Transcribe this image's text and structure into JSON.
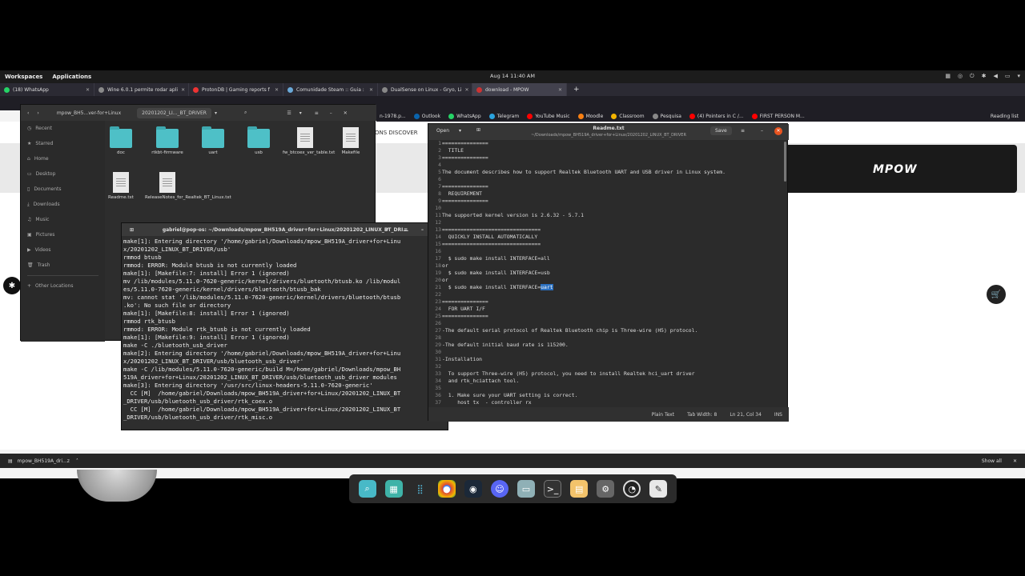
{
  "topbar": {
    "workspaces": "Workspaces",
    "applications": "Applications",
    "clock": "Aug 14  11:40 AM"
  },
  "tabs": [
    {
      "label": "(18) WhatsApp",
      "color": "#25d366"
    },
    {
      "label": "Wine 6.0.1 permite rodar apli",
      "color": "#8a8a8a"
    },
    {
      "label": "ProtonDB | Gaming reports f",
      "color": "#e33"
    },
    {
      "label": "Comunidade Steam :: Guia :",
      "color": "#1b2838"
    },
    {
      "label": "DualSense on Linux - Gryo, Li",
      "color": "#888"
    },
    {
      "label": "download - MPOW",
      "color": "#c33"
    }
  ],
  "bookmarks": [
    "n-1978.p...",
    "Outlook",
    "WhatsApp",
    "Telegram",
    "YouTube Music",
    "Moodle",
    "Classroom",
    "Pesquisa",
    "(4) Pointers in C /...",
    "FIRST PERSON M...",
    "Reading list"
  ],
  "webpage": {
    "discover": "ONS   DISCOVER",
    "logo": "MPOW"
  },
  "files": {
    "path_prefix": "mpow_BH5...ver-for+Linux",
    "path_current": "20201202_LI..._BT_DRIVER",
    "sidebar": [
      "Recent",
      "Starred",
      "Home",
      "Desktop",
      "Documents",
      "Downloads",
      "Music",
      "Pictures",
      "Videos",
      "Trash",
      "Other Locations"
    ],
    "items": [
      {
        "name": "doc",
        "type": "folder"
      },
      {
        "name": "rtkbt-firmware",
        "type": "folder"
      },
      {
        "name": "uart",
        "type": "folder"
      },
      {
        "name": "usb",
        "type": "folder"
      },
      {
        "name": "fw_btcoex_ver_table.txt",
        "type": "doc"
      },
      {
        "name": "Makefile",
        "type": "doc"
      },
      {
        "name": "Readme.txt",
        "type": "doc"
      },
      {
        "name": "ReleaseNotes_for_Realtek_BT_Linux.txt",
        "type": "doc"
      }
    ]
  },
  "terminal": {
    "title": "gabriel@pop-os: ~/Downloads/mpow_BH519A_driver+for+Linux/20201202_LINUX_BT_DRI...",
    "lines": "make[1]: Entering directory '/home/gabriel/Downloads/mpow_BH519A_driver+for+Linu\nx/20201202_LINUX_BT_DRIVER/usb'\nrmmod btusb\nrmmod: ERROR: Module btusb is not currently loaded\nmake[1]: [Makefile:7: install] Error 1 (ignored)\nmv /lib/modules/5.11.0-7620-generic/kernel/drivers/bluetooth/btusb.ko /lib/modul\nes/5.11.0-7620-generic/kernel/drivers/bluetooth/btusb_bak\nmv: cannot stat '/lib/modules/5.11.0-7620-generic/kernel/drivers/bluetooth/btusb\n.ko': No such file or directory\nmake[1]: [Makefile:8: install] Error 1 (ignored)\nrmmod rtk_btusb\nrmmod: ERROR: Module rtk_btusb is not currently loaded\nmake[1]: [Makefile:9: install] Error 1 (ignored)\nmake -C ./bluetooth_usb_driver\nmake[2]: Entering directory '/home/gabriel/Downloads/mpow_BH519A_driver+for+Linu\nx/20201202_LINUX_BT_DRIVER/usb/bluetooth_usb_driver'\nmake -C /lib/modules/5.11.0-7620-generic/build M=/home/gabriel/Downloads/mpow_BH\n519A_driver+for+Linux/20201202_LINUX_BT_DRIVER/usb/bluetooth_usb_driver modules\nmake[3]: Entering directory '/usr/src/linux-headers-5.11.0-7620-generic'\n  CC [M]  /home/gabriel/Downloads/mpow_BH519A_driver+for+Linux/20201202_LINUX_BT\n_DRIVER/usb/bluetooth_usb_driver/rtk_coex.o\n  CC [M]  /home/gabriel/Downloads/mpow_BH519A_driver+for+Linux/20201202_LINUX_BT\n_DRIVER/usb/bluetooth_usb_driver/rtk_misc.o"
  },
  "editor": {
    "open_label": "Open",
    "title": "Readme.txt",
    "subtitle": "~/Downloads/mpow_BH519A_driver+for+Linux/20201202_LINUX_BT_DRIVER",
    "save_label": "Save",
    "gutter": "1\n2\n3\n4\n5\n6\n7\n8\n9\n10\n11\n12\n13\n14\n15\n16\n17\n18\n19\n20\n21\n22\n23\n24\n25\n26\n27\n28\n29\n30\n31\n32\n33\n34\n35\n36\n37",
    "text_before": "===============\n  TITLE\n===============\n\nThe document describes how to support Realtek Bluetooth UART and USB driver in Linux system.\n\n===============\n  REQUIREMENT\n===============\n\nThe supported kernel version is 2.6.32 - 5.7.1\n\n================================\n  QUICKLY INSTALL AUTOMATICALLY\n================================\n\n  $ sudo make install INTERFACE=all\nor\n  $ sudo make install INTERFACE=usb\nor\n  $ sudo make install INTERFACE=",
    "text_selected": "uart",
    "text_after": "\n\n===============\n  FOR UART I/F\n===============\n\n-The default serial protocol of Realtek Bluetooth chip is Three-wire (H5) protocol.\n\n-The default initial baud rate is 115200.\n\n-Installation\n\n  To support Three-wire (H5) protocol, you need to install Realtek hci_uart driver\n  and rtk_hciattach tool.\n\n  1. Make sure your UART setting is correct.\n     host tx  - controller rx",
    "status": {
      "lang": "Plain Text",
      "tab": "Tab Width: 8",
      "pos": "Ln 21, Col 34",
      "mode": "INS"
    }
  },
  "downloads": {
    "file": "mpow_BH519A_dri...z",
    "show_all": "Show all"
  }
}
